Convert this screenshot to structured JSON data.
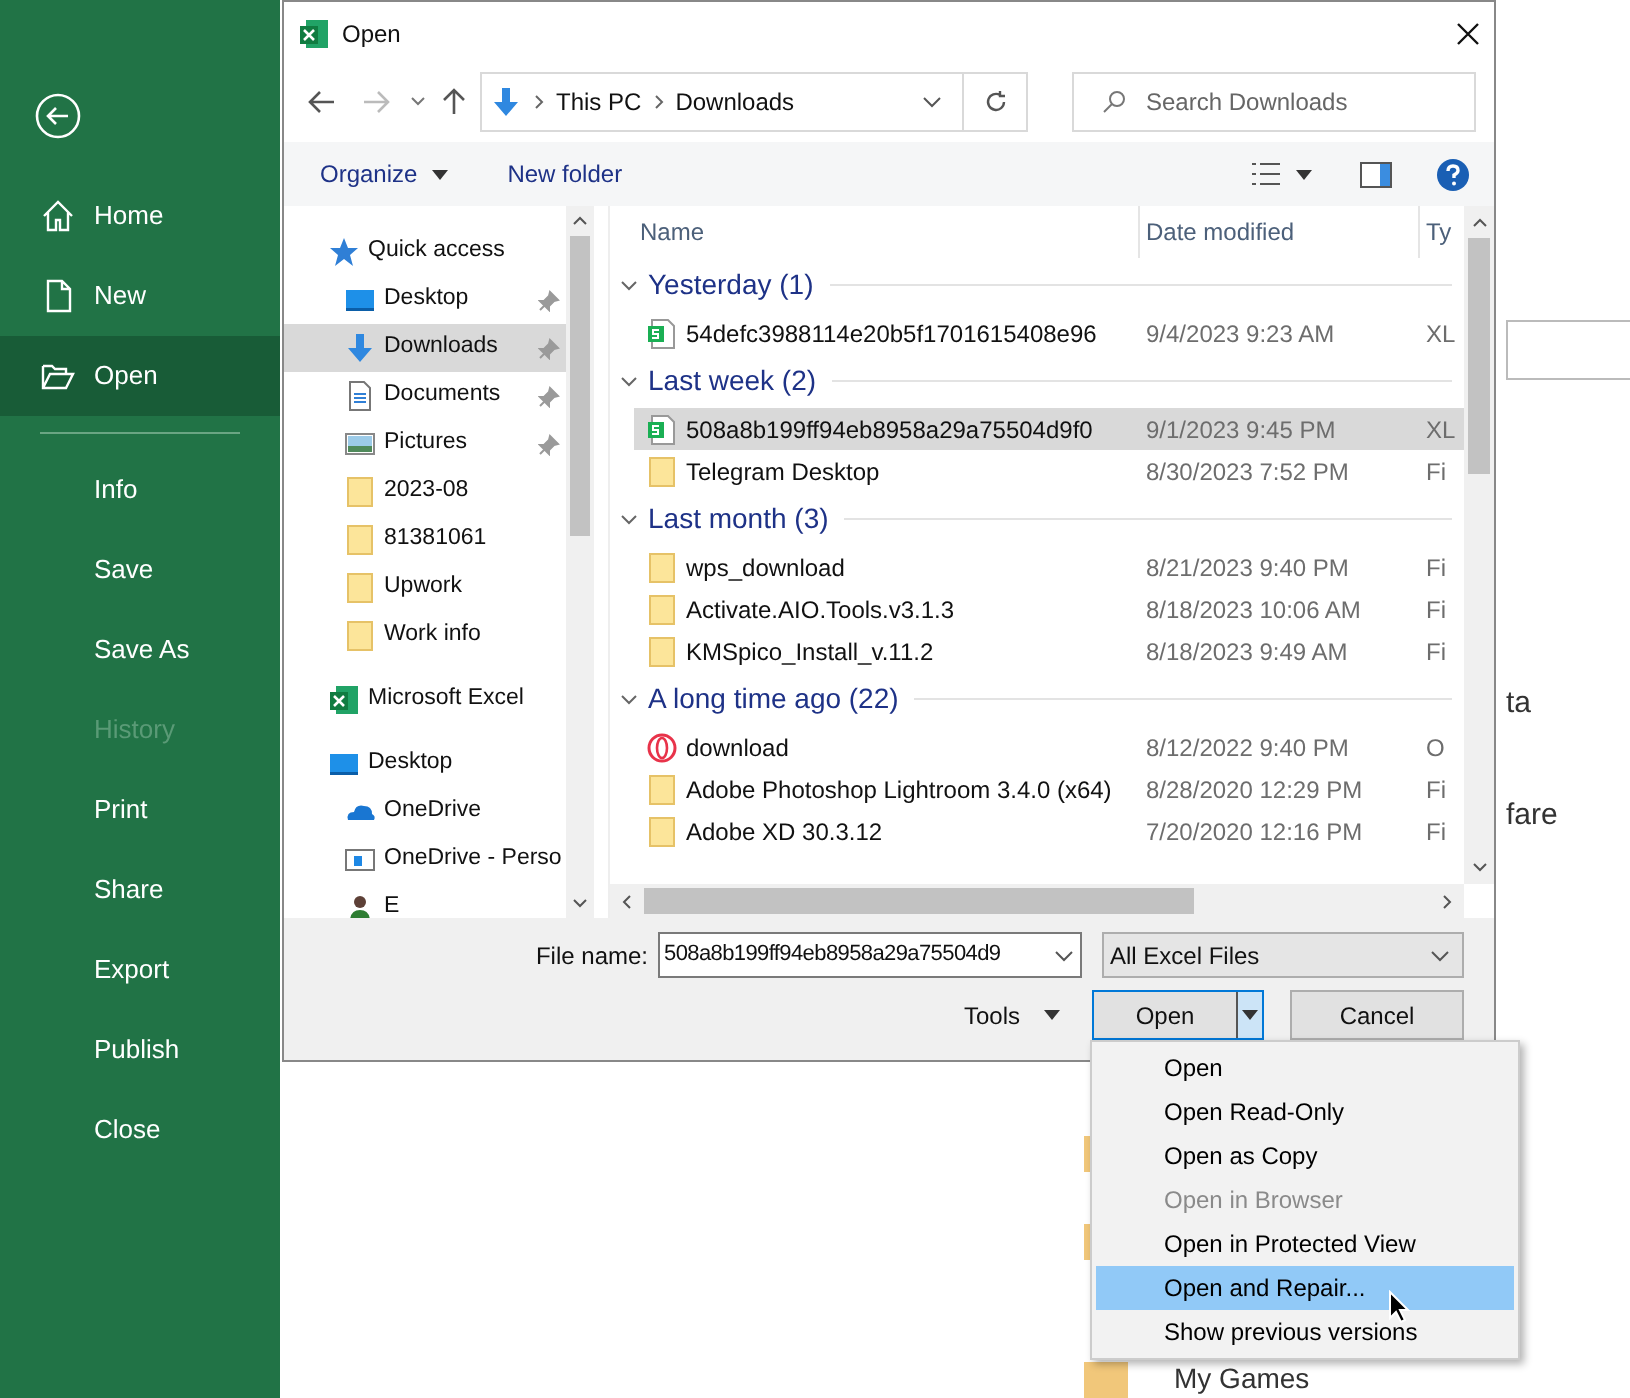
{
  "backstage": {
    "nav": [
      {
        "label": "Home",
        "kind": "home",
        "selected": false,
        "disabled": false
      },
      {
        "label": "New",
        "kind": "new",
        "selected": false,
        "disabled": false
      },
      {
        "label": "Open",
        "kind": "open",
        "selected": true,
        "disabled": false
      },
      {
        "label": "Info",
        "kind": "plain",
        "selected": false,
        "disabled": false
      },
      {
        "label": "Save",
        "kind": "plain",
        "selected": false,
        "disabled": false
      },
      {
        "label": "Save As",
        "kind": "plain",
        "selected": false,
        "disabled": false
      },
      {
        "label": "History",
        "kind": "plain",
        "selected": false,
        "disabled": true
      },
      {
        "label": "Print",
        "kind": "plain",
        "selected": false,
        "disabled": false
      },
      {
        "label": "Share",
        "kind": "plain",
        "selected": false,
        "disabled": false
      },
      {
        "label": "Export",
        "kind": "plain",
        "selected": false,
        "disabled": false
      },
      {
        "label": "Publish",
        "kind": "plain",
        "selected": false,
        "disabled": false
      },
      {
        "label": "Close",
        "kind": "plain",
        "selected": false,
        "disabled": false
      }
    ],
    "fragments": [
      "ta",
      "fare"
    ],
    "folder": "My Games"
  },
  "dialog": {
    "title": "Open",
    "address": [
      "This PC",
      "Downloads"
    ],
    "search": {
      "placeholder": "Search Downloads"
    },
    "toolbar": {
      "organize": "Organize",
      "new_folder": "New folder"
    },
    "nav_pane": [
      {
        "label": "Quick access",
        "kind": "star",
        "selected": false,
        "children": [
          {
            "label": "Desktop",
            "kind": "desktop",
            "selected": false,
            "pinned": true
          },
          {
            "label": "Downloads",
            "kind": "download",
            "selected": true,
            "pinned": true
          },
          {
            "label": "Documents",
            "kind": "document",
            "selected": false,
            "pinned": true
          },
          {
            "label": "Pictures",
            "kind": "picture",
            "selected": false,
            "pinned": true
          },
          {
            "label": "2023-08",
            "kind": "folder",
            "selected": false,
            "pinned": false
          },
          {
            "label": "81381061",
            "kind": "folder",
            "selected": false,
            "pinned": false
          },
          {
            "label": "Upwork",
            "kind": "folder",
            "selected": false,
            "pinned": false
          },
          {
            "label": "Work info",
            "kind": "folder",
            "selected": false,
            "pinned": false
          }
        ]
      },
      {
        "label": "Microsoft Excel",
        "kind": "excel",
        "selected": false
      },
      {
        "label": "Desktop",
        "kind": "desktop",
        "selected": false,
        "children": [
          {
            "label": "OneDrive",
            "kind": "cloud",
            "selected": false,
            "pinned": false
          },
          {
            "label": "OneDrive - Perso",
            "kind": "card",
            "selected": false,
            "pinned": false
          },
          {
            "label": "E",
            "kind": "person",
            "selected": false,
            "pinned": false
          }
        ]
      }
    ],
    "columns": [
      "Name",
      "Date modified",
      "Ty"
    ],
    "groups": [
      {
        "title": "Yesterday (1)",
        "items": [
          {
            "name": "54defc3988114e20b5f1701615408e96",
            "date": "9/4/2023 9:23 AM",
            "type": "XL",
            "kind": "sheet",
            "selected": false
          }
        ]
      },
      {
        "title": "Last week (2)",
        "items": [
          {
            "name": "508a8b199ff94eb8958a29a75504d9f0",
            "date": "9/1/2023 9:45 PM",
            "type": "XL",
            "kind": "sheet",
            "selected": true
          },
          {
            "name": "Telegram Desktop",
            "date": "8/30/2023 7:52 PM",
            "type": "Fi",
            "kind": "folder",
            "selected": false
          }
        ]
      },
      {
        "title": "Last month (3)",
        "items": [
          {
            "name": "wps_download",
            "date": "8/21/2023 9:40 PM",
            "type": "Fi",
            "kind": "folder",
            "selected": false
          },
          {
            "name": "Activate.AIO.Tools.v3.1.3",
            "date": "8/18/2023 10:06 AM",
            "type": "Fi",
            "kind": "folder",
            "selected": false
          },
          {
            "name": "KMSpico_Install_v.11.2",
            "date": "8/18/2023 9:49 AM",
            "type": "Fi",
            "kind": "folder",
            "selected": false
          }
        ]
      },
      {
        "title": "A long time ago (22)",
        "items": [
          {
            "name": "download",
            "date": "8/12/2022 9:40 PM",
            "type": "O",
            "kind": "ring",
            "selected": false
          },
          {
            "name": "Adobe Photoshop Lightroom 3.4.0 (x64)",
            "date": "8/28/2020 12:29 PM",
            "type": "Fi",
            "kind": "folder",
            "selected": false
          },
          {
            "name": "Adobe XD 30.3.12",
            "date": "7/20/2020 12:16 PM",
            "type": "Fi",
            "kind": "folder",
            "selected": false
          }
        ]
      }
    ],
    "file_name": {
      "label": "File name:",
      "value": "508a8b199ff94eb8958a29a75504d9"
    },
    "file_type": "All Excel Files",
    "tools": "Tools",
    "open": "Open",
    "cancel": "Cancel"
  },
  "open_menu": [
    {
      "label": "Open",
      "disabled": false,
      "selected": false
    },
    {
      "label": "Open Read-Only",
      "disabled": false,
      "selected": false
    },
    {
      "label": "Open as Copy",
      "disabled": false,
      "selected": false
    },
    {
      "label": "Open in Browser",
      "disabled": true,
      "selected": false
    },
    {
      "label": "Open in Protected View",
      "disabled": false,
      "selected": false
    },
    {
      "label": "Open and Repair...",
      "disabled": false,
      "selected": true
    },
    {
      "label": "Show previous versions",
      "disabled": false,
      "selected": false
    }
  ]
}
